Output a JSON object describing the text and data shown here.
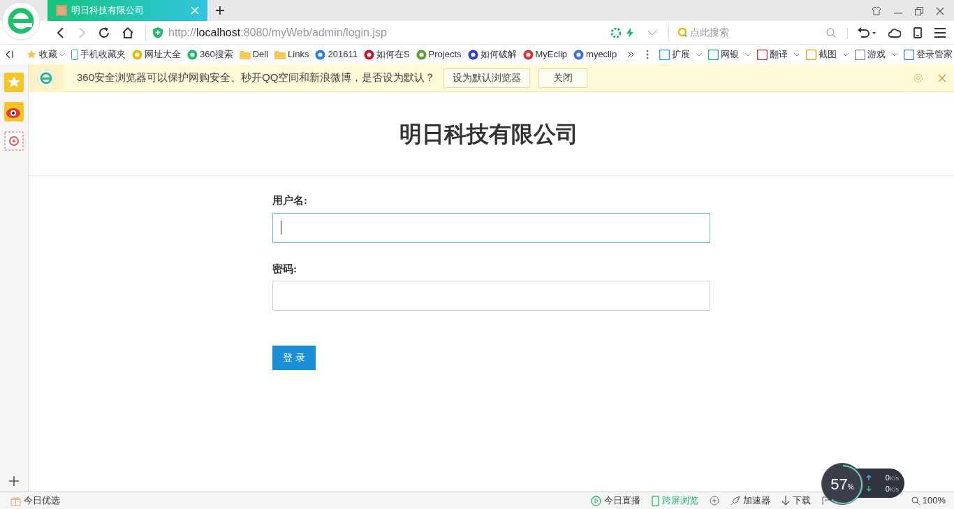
{
  "tab": {
    "title": "明日科技有限公司",
    "selected": true
  },
  "address": {
    "scheme": "http://",
    "host": "localhost",
    "path": ":8080/myWeb/admin/login.jsp"
  },
  "search": {
    "placeholder": "点此搜索"
  },
  "bookmarks": [
    {
      "kind": "star",
      "label": "收藏"
    },
    {
      "kind": "phone",
      "label": "手机收藏夹"
    },
    {
      "kind": "site",
      "label": "网址大全"
    },
    {
      "kind": "site",
      "label": "360搜索"
    },
    {
      "kind": "folder",
      "label": "Dell"
    },
    {
      "kind": "folder",
      "label": "Links"
    },
    {
      "kind": "site",
      "label": "201611"
    },
    {
      "kind": "site",
      "label": "如何在S"
    },
    {
      "kind": "site",
      "label": "Projects"
    },
    {
      "kind": "site",
      "label": "如何破解"
    },
    {
      "kind": "site",
      "label": "MyEclip"
    },
    {
      "kind": "site",
      "label": "myeclip"
    }
  ],
  "extensions": [
    "扩展",
    "网银",
    "翻译",
    "截图",
    "游戏",
    "登录管家"
  ],
  "notice": {
    "message": "360安全浏览器可以保护网购安全、秒开QQ空间和新浪微博，是否设为默认？",
    "buttons": [
      "设为默认浏览器",
      "关闭"
    ]
  },
  "page": {
    "heading": "明日科技有限公司",
    "fields": [
      {
        "label": "用户名:",
        "focused": true
      },
      {
        "label": "密码:",
        "focused": false
      }
    ],
    "submit": "登 录"
  },
  "status_bar": {
    "left": "今日优选",
    "items": [
      {
        "kind": "live",
        "label": "今日直播"
      },
      {
        "kind": "screen",
        "label": "跨屏浏览"
      },
      {
        "kind": "speedup",
        "label": "加速器"
      },
      {
        "kind": "download",
        "label": "下载"
      }
    ],
    "zoom": "100%"
  },
  "speed_widget": {
    "value": "57",
    "unit": "%",
    "up": "0",
    "up_unit": "K/s",
    "down": "0",
    "down_unit": "K/s"
  }
}
